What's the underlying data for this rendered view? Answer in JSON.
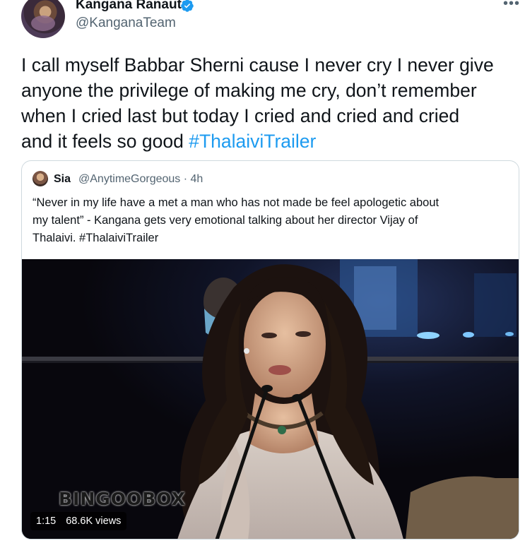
{
  "author": {
    "display_name": "Kangana Ranaut",
    "handle": "@KanganaTeam",
    "verified": true
  },
  "more_icon": "more-horizontal-icon",
  "tweet": {
    "lines": [
      "I call myself Babbar Sherni cause I never cry I never give",
      "anyone the privilege of making me cry, don’t remember",
      "when I cried last but today I cried and cried and cried",
      "and it feels so good "
    ],
    "hashtag": "#ThalaiviTrailer"
  },
  "quoted_tweet": {
    "name": "Sia",
    "handle_time": "@AnytimeGorgeous · 4h",
    "lines": [
      "“Never in my life have a met a man who has not made be feel apologetic about",
      "my talent” - Kangana gets very emotional talking about her director Vijay of",
      "Thalaivi. #ThalaiviTrailer"
    ],
    "video": {
      "watermark": "BINGOOBOX",
      "duration": "1:15",
      "views": "68.6K views"
    }
  },
  "colors": {
    "link": "#1d9bf0",
    "secondary_text": "#536471",
    "border": "#cfd9de",
    "verified": "#1d9bf0"
  }
}
